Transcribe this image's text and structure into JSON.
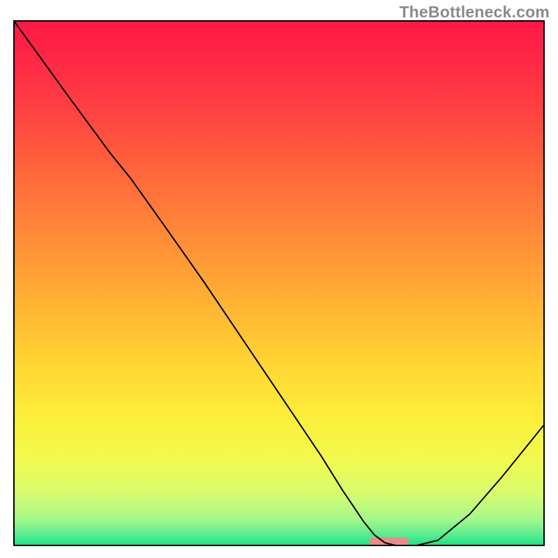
{
  "watermark": "TheBottleneck.com",
  "chart_data": {
    "type": "line",
    "title": "",
    "xlabel": "",
    "ylabel": "",
    "xlim": [
      0,
      100
    ],
    "ylim": [
      0,
      100
    ],
    "series": [
      {
        "name": "curve",
        "x": [
          0,
          10,
          18,
          22,
          28,
          36,
          44,
          52,
          58,
          62,
          66,
          68,
          70,
          72,
          76,
          80,
          86,
          92,
          100
        ],
        "y": [
          100,
          86,
          75,
          70,
          61.5,
          50,
          38,
          26,
          17,
          10.5,
          4.5,
          2,
          0.5,
          0,
          0,
          1,
          6,
          13,
          23
        ],
        "color": "#000000",
        "stroke_width": 2
      }
    ],
    "marker": {
      "x_start": 67,
      "x_end": 74.5,
      "y": 0.7,
      "color": "#e98b88",
      "height": 1.6
    },
    "gradient_stops": [
      {
        "offset": 0.0,
        "color": "#ff1846"
      },
      {
        "offset": 0.08,
        "color": "#ff2946"
      },
      {
        "offset": 0.18,
        "color": "#ff4441"
      },
      {
        "offset": 0.3,
        "color": "#ff6a3b"
      },
      {
        "offset": 0.42,
        "color": "#ff8e37"
      },
      {
        "offset": 0.55,
        "color": "#ffb634"
      },
      {
        "offset": 0.66,
        "color": "#ffd733"
      },
      {
        "offset": 0.76,
        "color": "#fbef3a"
      },
      {
        "offset": 0.84,
        "color": "#f2fa50"
      },
      {
        "offset": 0.9,
        "color": "#d8fb6e"
      },
      {
        "offset": 0.95,
        "color": "#a6f88b"
      },
      {
        "offset": 0.985,
        "color": "#4de990"
      },
      {
        "offset": 1.0,
        "color": "#18df82"
      }
    ],
    "frame_color": "#000000"
  }
}
